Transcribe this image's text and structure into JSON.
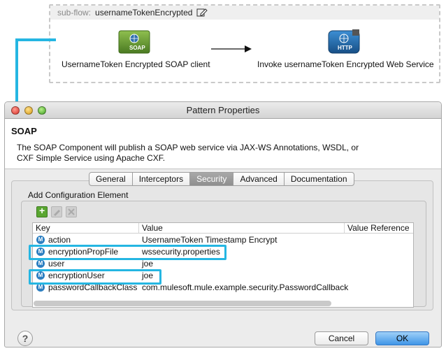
{
  "subflow": {
    "label": "sub-flow:",
    "name": "usernameTokenEncrypted",
    "nodes": [
      {
        "badge": "SOAP",
        "label": "UsernameToken Encrypted SOAP client"
      },
      {
        "badge": "HTTP",
        "label": "Invoke usernameToken Encrypted Web Service"
      }
    ]
  },
  "dialog": {
    "title": "Pattern Properties",
    "section_title": "SOAP",
    "description": "The SOAP Component will publish a SOAP web service via JAX-WS Annotations, WSDL, or CXF Simple Service using Apache CXF.",
    "tabs": [
      "General",
      "Interceptors",
      "Security",
      "Advanced",
      "Documentation"
    ],
    "active_tab": "Security",
    "group_title": "Add Configuration Element",
    "table": {
      "headers": [
        "Key",
        "Value",
        "Value Reference"
      ],
      "rows": [
        {
          "key": "action",
          "value": "UsernameToken Timestamp Encrypt"
        },
        {
          "key": "encryptionPropFile",
          "value": "wssecurity.properties"
        },
        {
          "key": "user",
          "value": "joe"
        },
        {
          "key": "encryptionUser",
          "value": "joe"
        },
        {
          "key": "passwordCallbackClass",
          "value": "com.mulesoft.mule.example.security.PasswordCallback"
        }
      ]
    },
    "buttons": {
      "help": "?",
      "cancel": "Cancel",
      "ok": "OK"
    }
  },
  "colors": {
    "highlight": "#25b6e2",
    "mule_icon": "#2d7fc1",
    "soap_node": "#5a8a2e",
    "http_node": "#1e6aa8"
  }
}
